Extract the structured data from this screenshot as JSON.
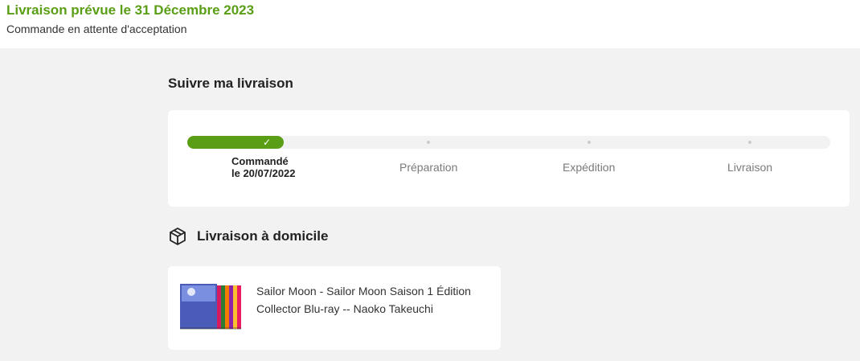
{
  "delivery": {
    "title": "Livraison prévue le 31 Décembre 2023",
    "status": "Commande en attente d'acceptation"
  },
  "tracking": {
    "title": "Suivre ma livraison",
    "progress_fraction": 0.15,
    "accent_color": "#5a9e16",
    "steps": [
      {
        "label": "Commandé",
        "date": "le 20/07/2022",
        "done": true
      },
      {
        "label": "Préparation",
        "done": false
      },
      {
        "label": "Expédition",
        "done": false
      },
      {
        "label": "Livraison",
        "done": false
      }
    ]
  },
  "home_delivery": {
    "title": "Livraison à domicile",
    "icon": "package-icon"
  },
  "product": {
    "name": "Sailor Moon - Sailor Moon Saison 1 Édition Collector Blu-ray -- Naoko Takeuchi",
    "image": "product-image"
  }
}
